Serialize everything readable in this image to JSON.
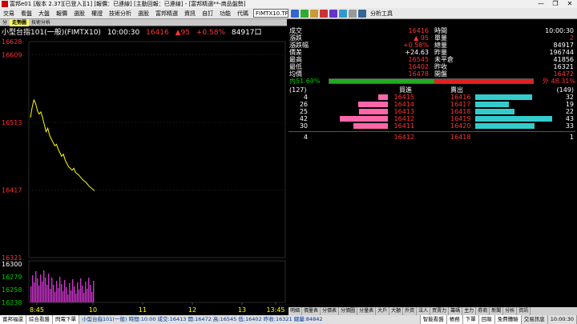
{
  "window": {
    "title": "富邦e01 [版本 2.37][已登入][1] [報價：已連線] [主動回報：已連線] - [富邦精選**-商品盤勢]",
    "min": "—",
    "max": "❐",
    "close": "✕"
  },
  "menu": {
    "items": [
      "交易",
      "看盤",
      "大盤",
      "報價",
      "選股",
      "權證",
      "技術分析",
      "選股",
      "富邦精選",
      "資訊",
      "自訂",
      "功能"
    ],
    "code_label": "代碼",
    "code_value": "FIMTX10.TF",
    "analysis": "分析工具"
  },
  "chart_tabs": [
    "分",
    "走勢圖",
    "技術分析"
  ],
  "chart_header": {
    "name": "小型台指101(一般)(FIMTX10)",
    "time": "10:00:30",
    "price": "16416",
    "change": "▲95",
    "pct": "+0.58%",
    "volume": "84917",
    "vol_mark": "口"
  },
  "chart_data": {
    "type": "line",
    "y_ticks": [
      "16628",
      "16609",
      "16513",
      "16417",
      "16321"
    ],
    "vol_ticks": [
      "16300",
      "16279",
      "16258",
      "16238"
    ],
    "x_ticks": [
      "8:45",
      "10",
      "11",
      "12",
      "13",
      "13:45"
    ],
    "ylim": [
      16321,
      16628
    ],
    "series": [
      {
        "values": [
          16520,
          16535,
          16545,
          16540,
          16530,
          16525,
          16528,
          16520,
          16510,
          16500,
          16505,
          16495,
          16490,
          16485,
          16480,
          16482,
          16475,
          16470,
          16465,
          16468,
          16460,
          16455,
          16450,
          16448,
          16445,
          16448,
          16442,
          16440,
          16438,
          16435,
          16432,
          16430,
          16428,
          16425,
          16422,
          16420,
          16418,
          16416
        ]
      }
    ]
  },
  "quote": {
    "left_labels": [
      "成交",
      "漲跌",
      "漲跌幅",
      "價差",
      "最高",
      "最低",
      "均價"
    ],
    "left_values": [
      "16416",
      "▲ 95",
      "+0.58%",
      "+24.63",
      "16545",
      "16402",
      "16478"
    ],
    "right_labels": [
      "時間",
      "單量",
      "總量",
      "昨量",
      "未平倉",
      "昨收",
      "開盤"
    ],
    "right_values": [
      "10:00:30",
      "2",
      "84917",
      "196744",
      "41856",
      "16321",
      "16472"
    ],
    "inner_pct": "內51.69%",
    "outer_pct": "外 48.31%",
    "bid_total": "(127)",
    "bid_label": "買進",
    "ask_label": "賣出",
    "ask_total": "(149)",
    "bids": [
      {
        "qty": "4",
        "price": "16415",
        "bar": 0.2
      },
      {
        "qty": "26",
        "price": "16414",
        "bar": 0.62
      },
      {
        "qty": "25",
        "price": "16413",
        "bar": 0.6
      },
      {
        "qty": "42",
        "price": "16412",
        "bar": 1.0
      },
      {
        "qty": "30",
        "price": "16411",
        "bar": 0.71
      }
    ],
    "asks": [
      {
        "qty": "32",
        "price": "16416",
        "bar": 0.74
      },
      {
        "qty": "19",
        "price": "16417",
        "bar": 0.44
      },
      {
        "qty": "22",
        "price": "16418",
        "bar": 0.51
      },
      {
        "qty": "43",
        "price": "16419",
        "bar": 1.0
      },
      {
        "qty": "33",
        "price": "16420",
        "bar": 0.77
      }
    ],
    "sum_bid_qty": "4",
    "sum_bid_price": "16412",
    "sum_ask_price": "16418",
    "sum_ask_qty": "1"
  },
  "bottom_tabs": [
    "明細",
    "價量表",
    "分價表",
    "分價圖",
    "分量表",
    "大戶",
    "大額",
    "外資",
    "法人",
    "買賣力",
    "籌碼",
    "主力",
    "券商",
    "新聞",
    "分析",
    "資訊"
  ],
  "status": {
    "items": [
      "富邦福還",
      "綜合看盤",
      "閃電下單"
    ],
    "ticker": "小型台指101(一般) 時間:10:00 成交:16413 開:16472 高:16545 低:16402 昨收:16321 總量:84842",
    "right": [
      "智能看盤",
      "帳務",
      "下單",
      "回報",
      "免費體驗",
      "交易訊息",
      "10:00:30"
    ]
  },
  "colors": {
    "price_line": "#ffff00",
    "volume": "#cc33cc",
    "bid_bar": "#ff66aa",
    "ask_bar": "#33cccc",
    "inner_bar": "#22aa22",
    "outer_bar": "#dd2222"
  }
}
